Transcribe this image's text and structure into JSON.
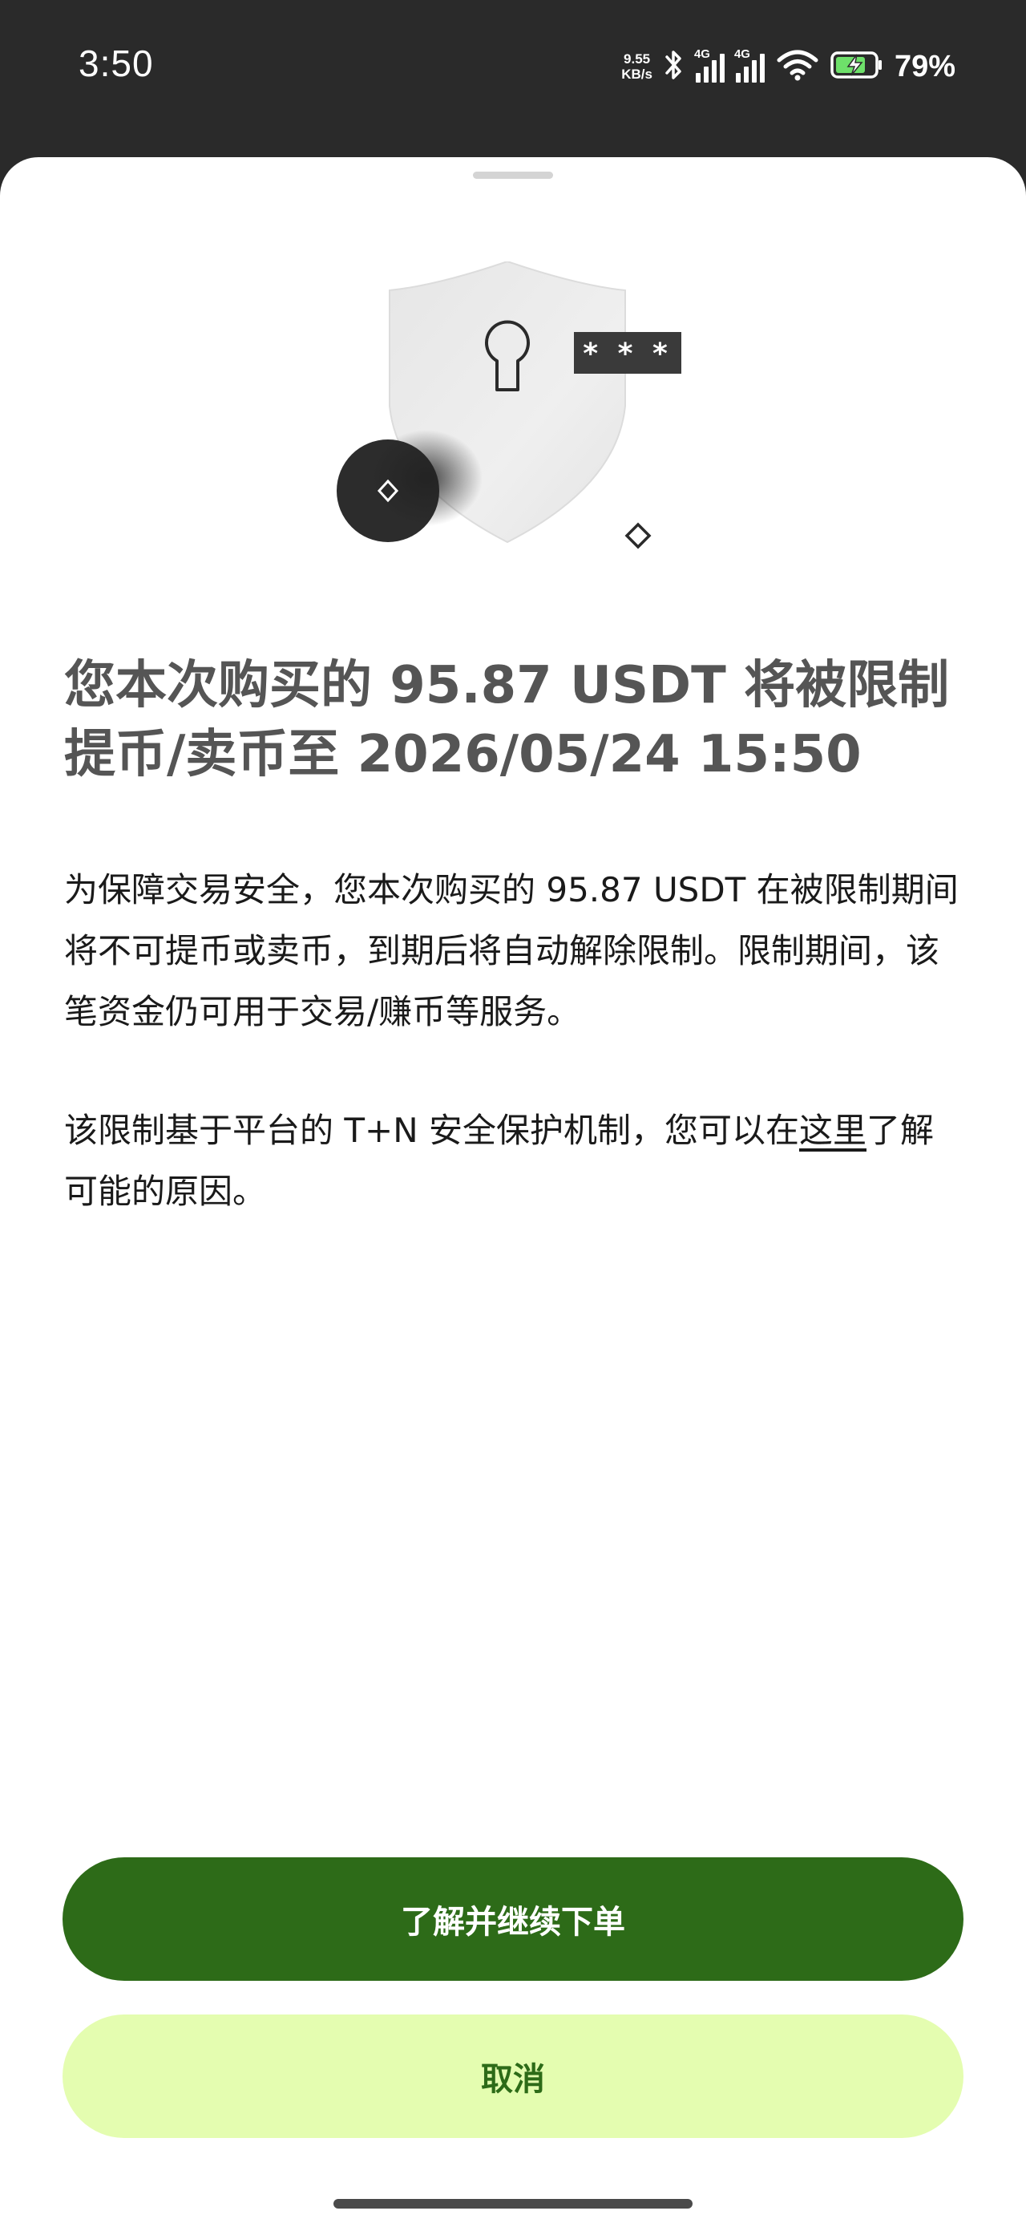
{
  "status_bar": {
    "time": "3:50",
    "net_speed_value": "9.55",
    "net_speed_unit": "KB/s",
    "network_1": "4G",
    "network_2": "4G",
    "battery": "79%"
  },
  "illustration": {
    "masked_text": "* * *",
    "icon": "shield-keyhole-icon"
  },
  "title": "您本次购买的 95.87 USDT 将被限制提币/卖币至 2026/05/24 15:50",
  "body": {
    "paragraph_1": "为保障交易安全，您本次购买的 95.87 USDT 在被限制期间将不可提币或卖币，到期后将自动解除限制。限制期间，该笔资金仍可用于交易/赚币等服务。",
    "paragraph_2_before_link": "该限制基于平台的 T+N 安全保护机制，您可以在",
    "paragraph_2_link": "这里",
    "paragraph_2_after_link": "了解可能的原因。"
  },
  "buttons": {
    "primary_label": "了解并继续下单",
    "cancel_label": "取消"
  },
  "colors": {
    "primary": "#2d6b18",
    "cancel_bg": "#e4fdb0",
    "status_bar_bg": "#2a2a2a"
  }
}
